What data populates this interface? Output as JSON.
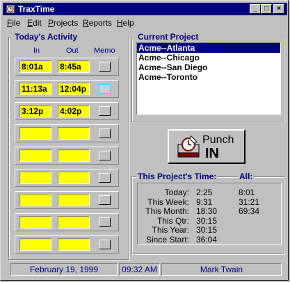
{
  "window": {
    "title": "TraxTime"
  },
  "menu": [
    {
      "label": "File",
      "accel": "F"
    },
    {
      "label": "Edit",
      "accel": "E"
    },
    {
      "label": "Projects",
      "accel": "P"
    },
    {
      "label": "Reports",
      "accel": "R"
    },
    {
      "label": "Help",
      "accel": "H"
    }
  ],
  "activity": {
    "title": "Today's Activity",
    "col_in": "In",
    "col_out": "Out",
    "col_memo": "Memo",
    "rows": [
      {
        "in": "8:01a",
        "out": "8:45a"
      },
      {
        "in": "11:13a",
        "out": "12:04p"
      },
      {
        "in": "3:12p",
        "out": "4:02p"
      },
      {
        "in": "",
        "out": ""
      },
      {
        "in": "",
        "out": ""
      },
      {
        "in": "",
        "out": ""
      },
      {
        "in": "",
        "out": ""
      },
      {
        "in": "",
        "out": ""
      },
      {
        "in": "",
        "out": ""
      }
    ]
  },
  "project": {
    "title": "Current Project",
    "items": [
      "Acme--Atlanta",
      "Acme--Chicago",
      "Acme--San Diego",
      "Acme--Toronto"
    ],
    "selected_index": 0
  },
  "punch": {
    "line1": "Punch",
    "line2": "IN"
  },
  "times": {
    "title": "This Project's Time:",
    "all_label": "All:",
    "rows": [
      {
        "label": "Today:",
        "project": "2:25",
        "all": "8:01"
      },
      {
        "label": "This Week:",
        "project": "9:31",
        "all": "31:21"
      },
      {
        "label": "This Month:",
        "project": "18:30",
        "all": "69:34"
      },
      {
        "label": "This Qtr:",
        "project": "30:15",
        "all": ""
      },
      {
        "label": "This Year:",
        "project": "30:15",
        "all": ""
      },
      {
        "label": "Since Start:",
        "project": "36:04",
        "all": ""
      }
    ]
  },
  "status": {
    "date": "February 19, 1999",
    "time": "09:32 AM",
    "user": "Mark Twain"
  },
  "colors": {
    "title_bar": "#000080",
    "time_field": "#ffff00",
    "selection": "#000080"
  }
}
